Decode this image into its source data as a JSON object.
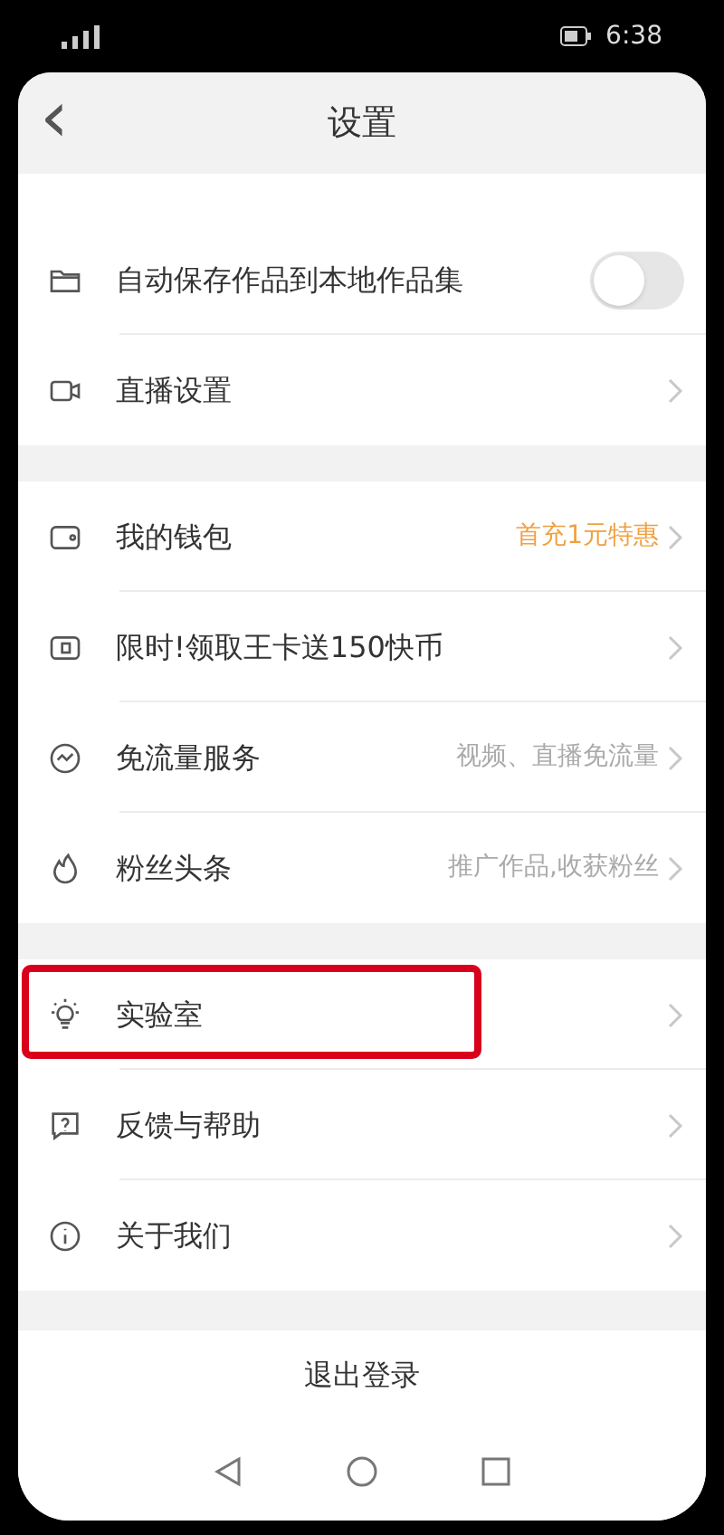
{
  "status_bar": {
    "time": "6:38"
  },
  "header": {
    "back": "‹",
    "title": "设置"
  },
  "sections": [
    {
      "items": [
        {
          "kind": "toggle",
          "label": "自动保存作品到本地作品集",
          "on": false
        },
        {
          "kind": "link",
          "label": "直播设置"
        }
      ]
    },
    {
      "items": [
        {
          "kind": "link",
          "label": "我的钱包",
          "value": "首充1元特惠",
          "accent": true
        },
        {
          "kind": "link",
          "label": "限时!领取王卡送150快币"
        },
        {
          "kind": "link",
          "label": "免流量服务",
          "value": "视频、直播免流量",
          "accent": false
        },
        {
          "kind": "link",
          "label": "粉丝头条",
          "value": "推广作品,收获粉丝",
          "accent": false
        }
      ]
    },
    {
      "items": [
        {
          "kind": "link",
          "label": "实验室",
          "highlighted": true
        },
        {
          "kind": "link",
          "label": "反馈与帮助",
          "highlighted": false
        },
        {
          "kind": "link",
          "label": "关于我们",
          "highlighted": false
        }
      ]
    }
  ],
  "logout": "退出登录"
}
